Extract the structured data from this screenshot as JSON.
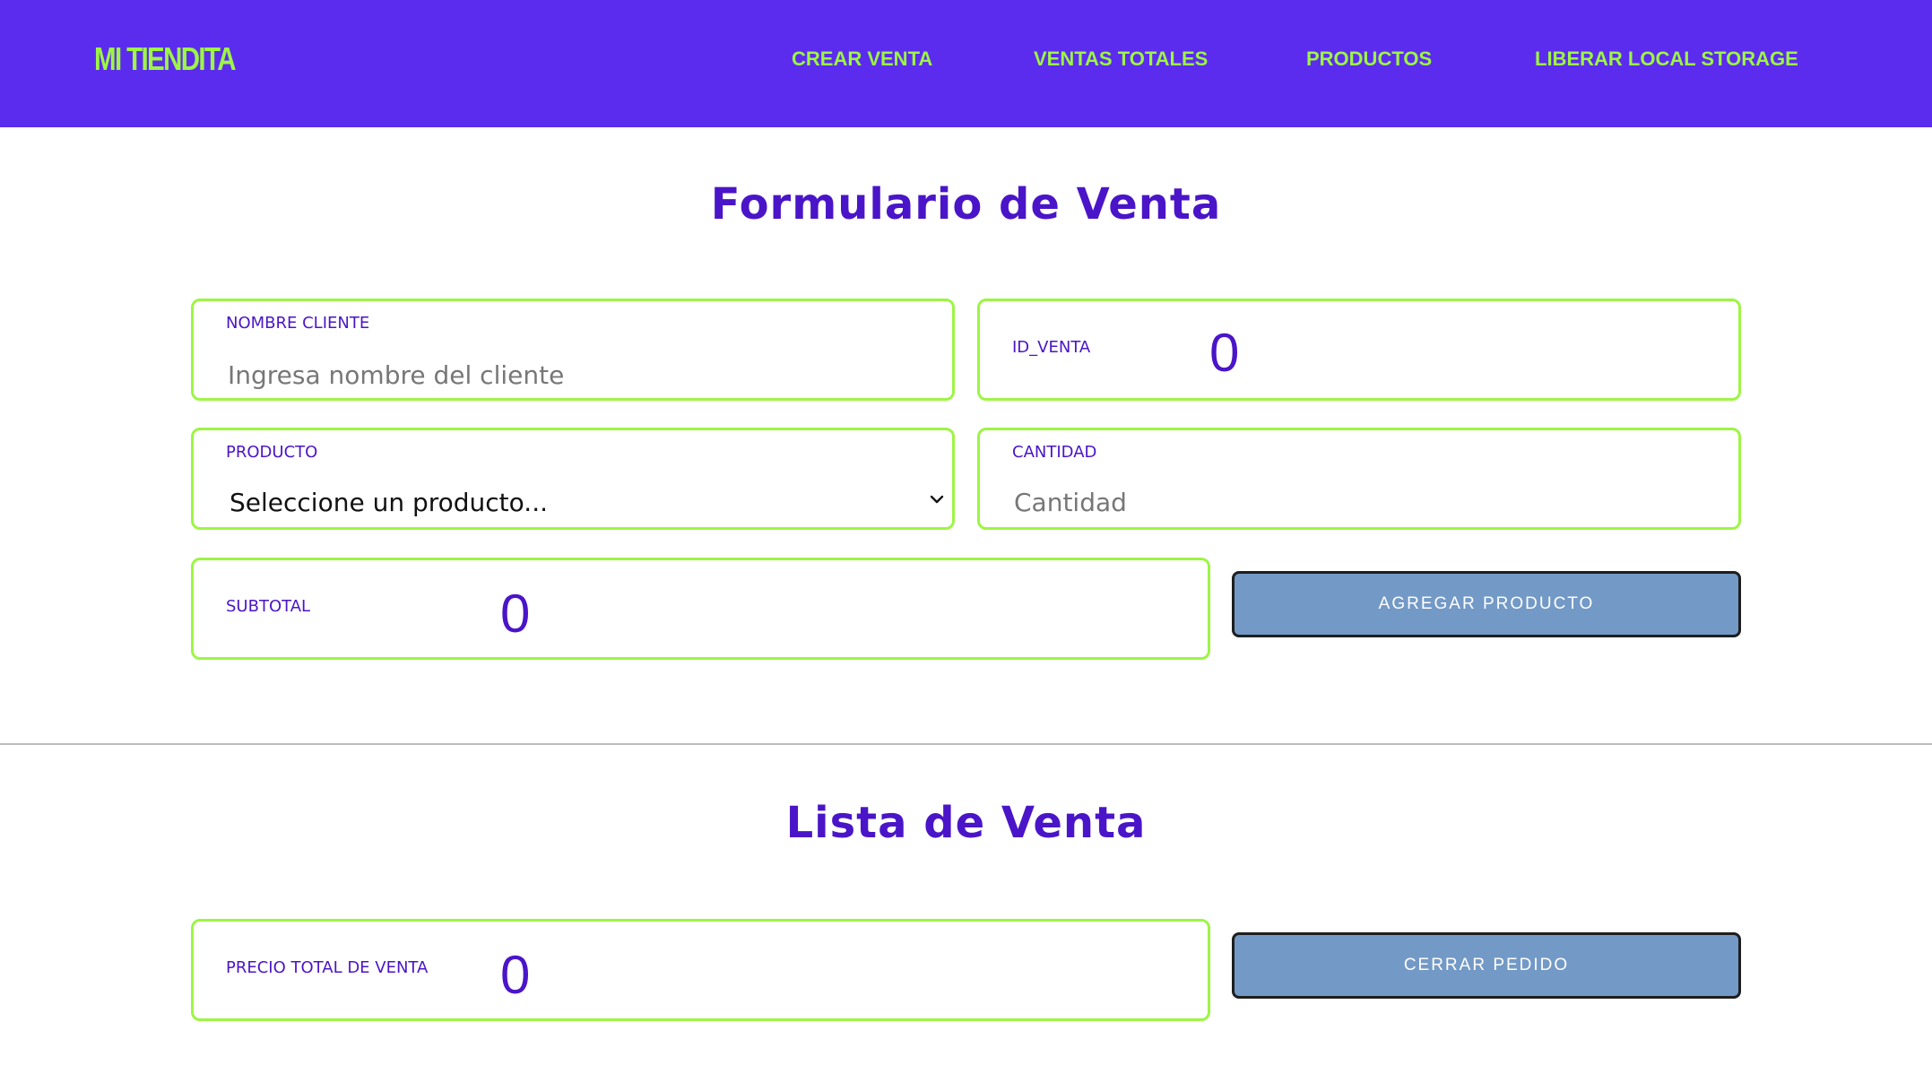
{
  "navbar": {
    "brand": "MI TIENDITA",
    "links": [
      "CREAR VENTA",
      "VENTAS TOTALES",
      "PRODUCTOS",
      "LIBERAR LOCAL STORAGE"
    ]
  },
  "form": {
    "title": "Formulario de Venta",
    "nombre_cliente": {
      "label": "NOMBRE CLIENTE",
      "placeholder": "Ingresa nombre del cliente",
      "value": ""
    },
    "id_venta": {
      "label": "ID_VENTA",
      "value": "0"
    },
    "producto": {
      "label": "PRODUCTO",
      "selected": "Seleccione un producto..."
    },
    "cantidad": {
      "label": "CANTIDAD",
      "placeholder": "Cantidad",
      "value": ""
    },
    "subtotal": {
      "label": "SUBTOTAL",
      "value": "0"
    },
    "agregar_button": "AGREGAR PRODUCTO"
  },
  "list": {
    "title": "Lista de Venta",
    "precio_total": {
      "label": "PRECIO TOTAL DE VENTA",
      "value": "0"
    },
    "cerrar_button": "CERRAR PEDIDO"
  },
  "colors": {
    "navbar_bg": "#5b2ced",
    "brand_green": "#9df544",
    "accent_purple": "#4a15c8",
    "button_blue": "#7399c6"
  }
}
